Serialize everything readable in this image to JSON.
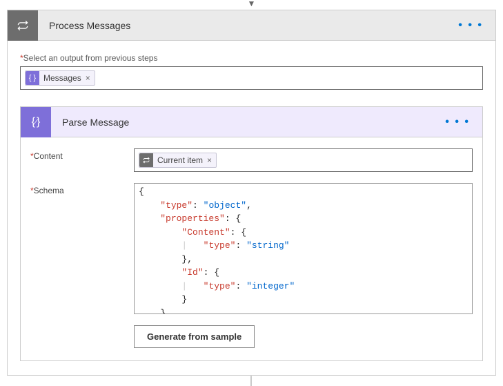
{
  "outer": {
    "title": "Process Messages",
    "outputLabel": "Select an output from previous steps",
    "token": {
      "label": "Messages"
    }
  },
  "inner": {
    "title": "Parse Message",
    "contentLabel": "Content",
    "contentToken": {
      "label": "Current item"
    },
    "schemaLabel": "Schema",
    "generateBtn": "Generate from sample",
    "schemaLines": [
      {
        "indent": 0,
        "parts": [
          {
            "t": "pun",
            "v": "{"
          }
        ]
      },
      {
        "indent": 1,
        "parts": [
          {
            "t": "key",
            "v": "\"type\""
          },
          {
            "t": "pun",
            "v": ": "
          },
          {
            "t": "str",
            "v": "\"object\""
          },
          {
            "t": "pun",
            "v": ","
          }
        ]
      },
      {
        "indent": 1,
        "parts": [
          {
            "t": "key",
            "v": "\"properties\""
          },
          {
            "t": "pun",
            "v": ": {"
          }
        ]
      },
      {
        "indent": 2,
        "parts": [
          {
            "t": "key",
            "v": "\"Content\""
          },
          {
            "t": "pun",
            "v": ": {"
          }
        ]
      },
      {
        "indent": 3,
        "guide": true,
        "parts": [
          {
            "t": "key",
            "v": "\"type\""
          },
          {
            "t": "pun",
            "v": ": "
          },
          {
            "t": "str",
            "v": "\"string\""
          }
        ]
      },
      {
        "indent": 2,
        "parts": [
          {
            "t": "pun",
            "v": "},"
          }
        ]
      },
      {
        "indent": 2,
        "parts": [
          {
            "t": "key",
            "v": "\"Id\""
          },
          {
            "t": "pun",
            "v": ": {"
          }
        ]
      },
      {
        "indent": 3,
        "guide": true,
        "parts": [
          {
            "t": "key",
            "v": "\"type\""
          },
          {
            "t": "pun",
            "v": ": "
          },
          {
            "t": "str",
            "v": "\"integer\""
          }
        ]
      },
      {
        "indent": 2,
        "parts": [
          {
            "t": "pun",
            "v": "}"
          }
        ]
      },
      {
        "indent": 1,
        "parts": [
          {
            "t": "pun",
            "v": "}"
          }
        ]
      }
    ]
  }
}
